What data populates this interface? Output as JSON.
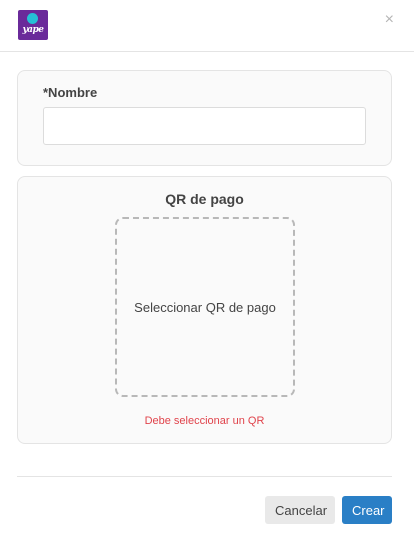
{
  "header": {
    "logo_text": "yape",
    "close_icon": "close-icon",
    "close_glyph": "×"
  },
  "name_card": {
    "label": "*Nombre",
    "value": "",
    "placeholder": ""
  },
  "qr_card": {
    "title": "QR de pago",
    "dropzone_label": "Seleccionar QR de pago",
    "error": "Debe seleccionar un QR"
  },
  "footer": {
    "cancel_label": "Cancelar",
    "create_label": "Crear"
  },
  "colors": {
    "brand_purple": "#6a2a9a",
    "primary": "#2a7fc6",
    "error": "#e0434b"
  }
}
